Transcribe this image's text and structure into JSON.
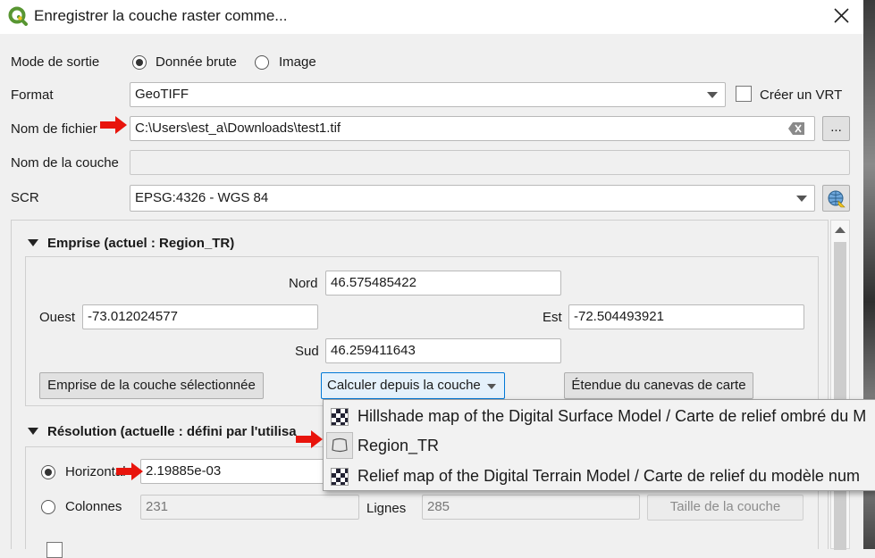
{
  "window": {
    "title": "Enregistrer la couche raster comme..."
  },
  "form": {
    "output_mode_label": "Mode de sortie",
    "raw_data_label": "Donnée brute",
    "image_label": "Image",
    "format_label": "Format",
    "format_value": "GeoTIFF",
    "create_vrt_label": "Créer un VRT",
    "filename_label": "Nom de fichier",
    "filename_value": "C:\\Users\\est_a\\Downloads\\test1.tif",
    "browse_label": "...",
    "layer_name_label": "Nom de la couche",
    "crs_label": "SCR",
    "crs_value": "EPSG:4326 - WGS 84"
  },
  "extent": {
    "title": "Emprise (actuel : Region_TR)",
    "north_label": "Nord",
    "north_value": "46.575485422",
    "west_label": "Ouest",
    "west_value": "-73.012024577",
    "east_label": "Est",
    "east_value": "-72.504493921",
    "south_label": "Sud",
    "south_value": "46.259411643",
    "selected_layer_button": "Emprise de la couche sélectionnée",
    "calc_from_layer_button": "Calculer depuis la couche",
    "canvas_extent_button": "Étendue du canevas de carte"
  },
  "resolution": {
    "title": "Résolution (actuelle : défini par l'utilisa",
    "horizontal_label": "Horizontal",
    "horizontal_value": "2.19885e-03",
    "columns_label": "Colonnes",
    "columns_value": "231",
    "rows_label": "Lignes",
    "rows_value": "285",
    "layer_size_button": "Taille de la couche"
  },
  "layer_menu": {
    "items": [
      {
        "label": "Hillshade map of the Digital Surface Model / Carte de relief ombré du M",
        "icon": "raster-layer-icon"
      },
      {
        "label": "Region_TR",
        "icon": "polygon-layer-icon"
      },
      {
        "label": "Relief map of the Digital Terrain Model / Carte de relief du modèle num",
        "icon": "raster-layer-icon"
      }
    ]
  },
  "colors": {
    "annotation_arrow": "#e8140c",
    "qgis_green": "#589632",
    "qgis_yellow": "#f0c41e"
  }
}
